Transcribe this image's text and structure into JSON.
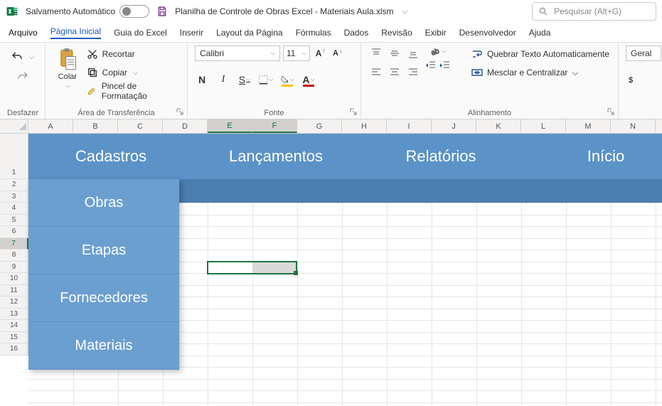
{
  "titlebar": {
    "auto_save_label": "Salvamento Automático",
    "filename": "Planilha de Controle de Obras Excel - Materiais Aula.xlsm",
    "search_placeholder": "Pesquisar (Alt+G)"
  },
  "menu": {
    "file": "Arquivo",
    "home": "Página Inicial",
    "guide": "Guia do Excel",
    "insert": "Inserir",
    "layout": "Layout da Página",
    "formulas": "Fórmulas",
    "data": "Dados",
    "review": "Revisão",
    "view": "Exibir",
    "developer": "Desenvolvedor",
    "help": "Ajuda"
  },
  "ribbon": {
    "undo_group": "Desfazer",
    "clipboard": {
      "paste": "Colar",
      "cut": "Recortar",
      "copy": "Copiar",
      "painter": "Pincel de Formatação",
      "group": "Área de Transferência"
    },
    "font": {
      "name": "Calibri",
      "size": "11",
      "bold": "N",
      "italic": "I",
      "underline": "S",
      "group": "Fonte",
      "fill_color": "#ffc000",
      "font_color": "#c00000"
    },
    "alignment": {
      "wrap": "Quebrar Texto Automaticamente",
      "merge": "Mesclar e Centralizar",
      "group": "Alinhamento"
    },
    "number": {
      "format": "Geral"
    }
  },
  "columns": [
    "A",
    "B",
    "C",
    "D",
    "E",
    "F",
    "G",
    "H",
    "I",
    "J",
    "K",
    "L",
    "M",
    "N"
  ],
  "rows_visible": [
    "1",
    "2",
    "3",
    "4",
    "5",
    "6",
    "7",
    "8",
    "9",
    "10",
    "11",
    "12",
    "13",
    "14",
    "15",
    "16"
  ],
  "selected_cols": [
    "E",
    "F"
  ],
  "selected_row": "7",
  "nav": {
    "tabs": [
      "Cadastros",
      "Lançamentos",
      "Relatórios",
      "Início"
    ],
    "dropdown": [
      "Obras",
      "Etapas",
      "Fornecedores",
      "Materiais"
    ]
  }
}
